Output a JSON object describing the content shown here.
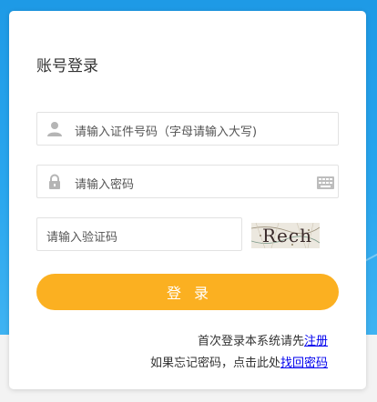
{
  "title": "账号登录",
  "fields": {
    "id_placeholder": "请输入证件号码（字母请输入大写)",
    "password_placeholder": "请输入密码",
    "captcha_placeholder": "请输入验证码"
  },
  "captcha_text": "Rech",
  "login_button": "登录",
  "register": {
    "prefix": "首次登录本系统请先",
    "link": "注册"
  },
  "forgot": {
    "prefix": "如果忘记密码，点击此处",
    "link": "找回密码"
  },
  "icons": {
    "user": "user-icon",
    "lock": "lock-icon",
    "keyboard": "keyboard-icon"
  },
  "colors": {
    "primary_blue": "#29a6ee",
    "button_orange": "#fbb021",
    "link_blue": "#0000ee"
  }
}
